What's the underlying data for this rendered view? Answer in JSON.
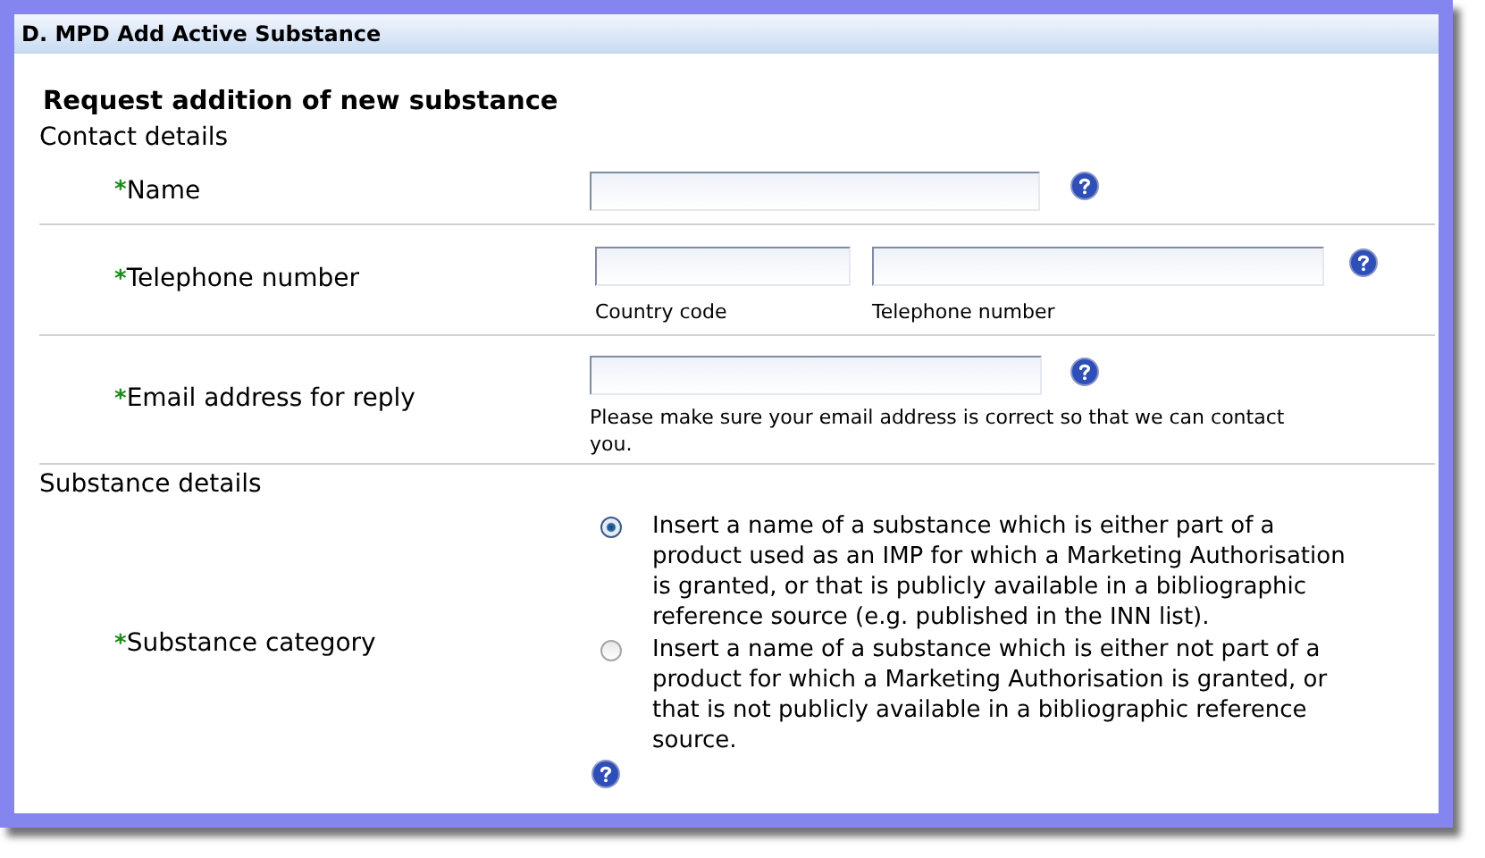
{
  "panel": {
    "title": "D. MPD Add Active Substance"
  },
  "heading": "Request addition of new substance",
  "sections": [
    {
      "title": "Contact details",
      "rows": [
        {
          "kind": "text",
          "marker": "*",
          "label": "Name"
        },
        {
          "kind": "phone",
          "marker": "*",
          "label": "Telephone number",
          "captions": [
            "Country code",
            "Telephone number"
          ]
        },
        {
          "kind": "email",
          "marker": "*",
          "label": "Email address for reply",
          "note": "Please make sure your email address is correct so that we can contact you."
        }
      ]
    },
    {
      "title": "Substance details",
      "rows": [
        {
          "kind": "radio",
          "marker": "*",
          "label": "Substance category",
          "options": [
            {
              "text": "Insert a name of a substance which is either part of a product used as an IMP for which a Marketing Authorisation is granted, or that is publicly available in a bibliographic reference source (e.g. published in the INN list).",
              "selected": true
            },
            {
              "text": "Insert a name of a substance which is either not part of a product for which a Marketing Authorisation is granted, or that is not publicly available in a bibliographic reference source.",
              "selected": false
            }
          ]
        }
      ]
    }
  ]
}
